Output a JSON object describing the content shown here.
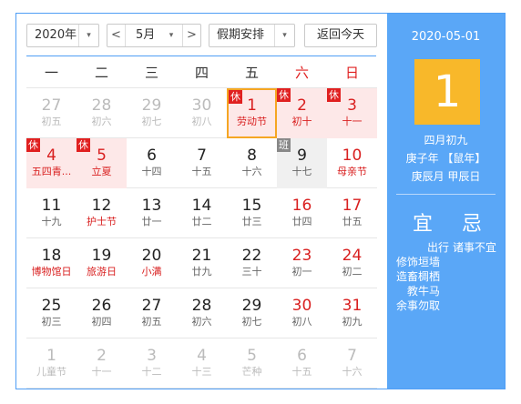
{
  "toolbar": {
    "year": "2020年",
    "month": "5月",
    "prev": "<",
    "next": ">",
    "holiday_select": "假期安排",
    "dropdown_glyph": "▾",
    "today_button": "返回今天"
  },
  "weekdays": [
    "一",
    "二",
    "三",
    "四",
    "五",
    "六",
    "日"
  ],
  "weeks": [
    [
      {
        "day": "27",
        "lunar": "初五",
        "other": true
      },
      {
        "day": "28",
        "lunar": "初六",
        "other": true
      },
      {
        "day": "29",
        "lunar": "初七",
        "other": true
      },
      {
        "day": "30",
        "lunar": "初八",
        "other": true
      },
      {
        "day": "1",
        "lunar": "劳动节",
        "holiday": true,
        "badge": "休",
        "selected": true
      },
      {
        "day": "2",
        "lunar": "初十",
        "holiday": true,
        "badge": "休"
      },
      {
        "day": "3",
        "lunar": "十一",
        "holiday": true,
        "badge": "休"
      }
    ],
    [
      {
        "day": "4",
        "lunar": "五四青...",
        "holiday": true,
        "badge": "休"
      },
      {
        "day": "5",
        "lunar": "立夏",
        "holiday": true,
        "badge": "休"
      },
      {
        "day": "6",
        "lunar": "十四"
      },
      {
        "day": "7",
        "lunar": "十五"
      },
      {
        "day": "8",
        "lunar": "十六"
      },
      {
        "day": "9",
        "lunar": "十七",
        "workday": true,
        "badge": "班"
      },
      {
        "day": "10",
        "lunar": "母亲节",
        "weekend": true,
        "festival": true
      }
    ],
    [
      {
        "day": "11",
        "lunar": "十九"
      },
      {
        "day": "12",
        "lunar": "护士节",
        "festival": true
      },
      {
        "day": "13",
        "lunar": "廿一"
      },
      {
        "day": "14",
        "lunar": "廿二"
      },
      {
        "day": "15",
        "lunar": "廿三"
      },
      {
        "day": "16",
        "lunar": "廿四",
        "weekend": true
      },
      {
        "day": "17",
        "lunar": "廿五",
        "weekend": true
      }
    ],
    [
      {
        "day": "18",
        "lunar": "博物馆日",
        "festival": true
      },
      {
        "day": "19",
        "lunar": "旅游日",
        "festival": true
      },
      {
        "day": "20",
        "lunar": "小满",
        "festival": true
      },
      {
        "day": "21",
        "lunar": "廿九"
      },
      {
        "day": "22",
        "lunar": "三十"
      },
      {
        "day": "23",
        "lunar": "初一",
        "weekend": true
      },
      {
        "day": "24",
        "lunar": "初二",
        "weekend": true
      }
    ],
    [
      {
        "day": "25",
        "lunar": "初三"
      },
      {
        "day": "26",
        "lunar": "初四"
      },
      {
        "day": "27",
        "lunar": "初五"
      },
      {
        "day": "28",
        "lunar": "初六"
      },
      {
        "day": "29",
        "lunar": "初七"
      },
      {
        "day": "30",
        "lunar": "初八",
        "weekend": true
      },
      {
        "day": "31",
        "lunar": "初九",
        "weekend": true
      }
    ],
    [
      {
        "day": "1",
        "lunar": "儿童节",
        "other": true
      },
      {
        "day": "2",
        "lunar": "十一",
        "other": true
      },
      {
        "day": "3",
        "lunar": "十二",
        "other": true
      },
      {
        "day": "4",
        "lunar": "十三",
        "other": true
      },
      {
        "day": "5",
        "lunar": "芒种",
        "other": true
      },
      {
        "day": "6",
        "lunar": "十五",
        "other": true
      },
      {
        "day": "7",
        "lunar": "十六",
        "other": true
      }
    ]
  ],
  "panel": {
    "date": "2020-05-01",
    "big_day": "1",
    "lunar_date": "四月初九",
    "ganzhi_year": "庚子年 【鼠年】",
    "ganzhi_month_day": "庚辰月 甲辰日",
    "yi_label": "宜",
    "ji_label": "忌",
    "yi_items": [
      "出行",
      "修饰垣墙",
      "造畜椆栖",
      "教牛马",
      "余事勿取"
    ],
    "ji_items": [
      "诸事不宜"
    ]
  },
  "colors": {
    "accent": "#4f9ef5",
    "panel_bg": "#5aa7f7",
    "big_day_bg": "#f8b82a",
    "holiday_bg": "#fde8e8",
    "red": "#e02020",
    "selected_border": "#f5a623"
  }
}
